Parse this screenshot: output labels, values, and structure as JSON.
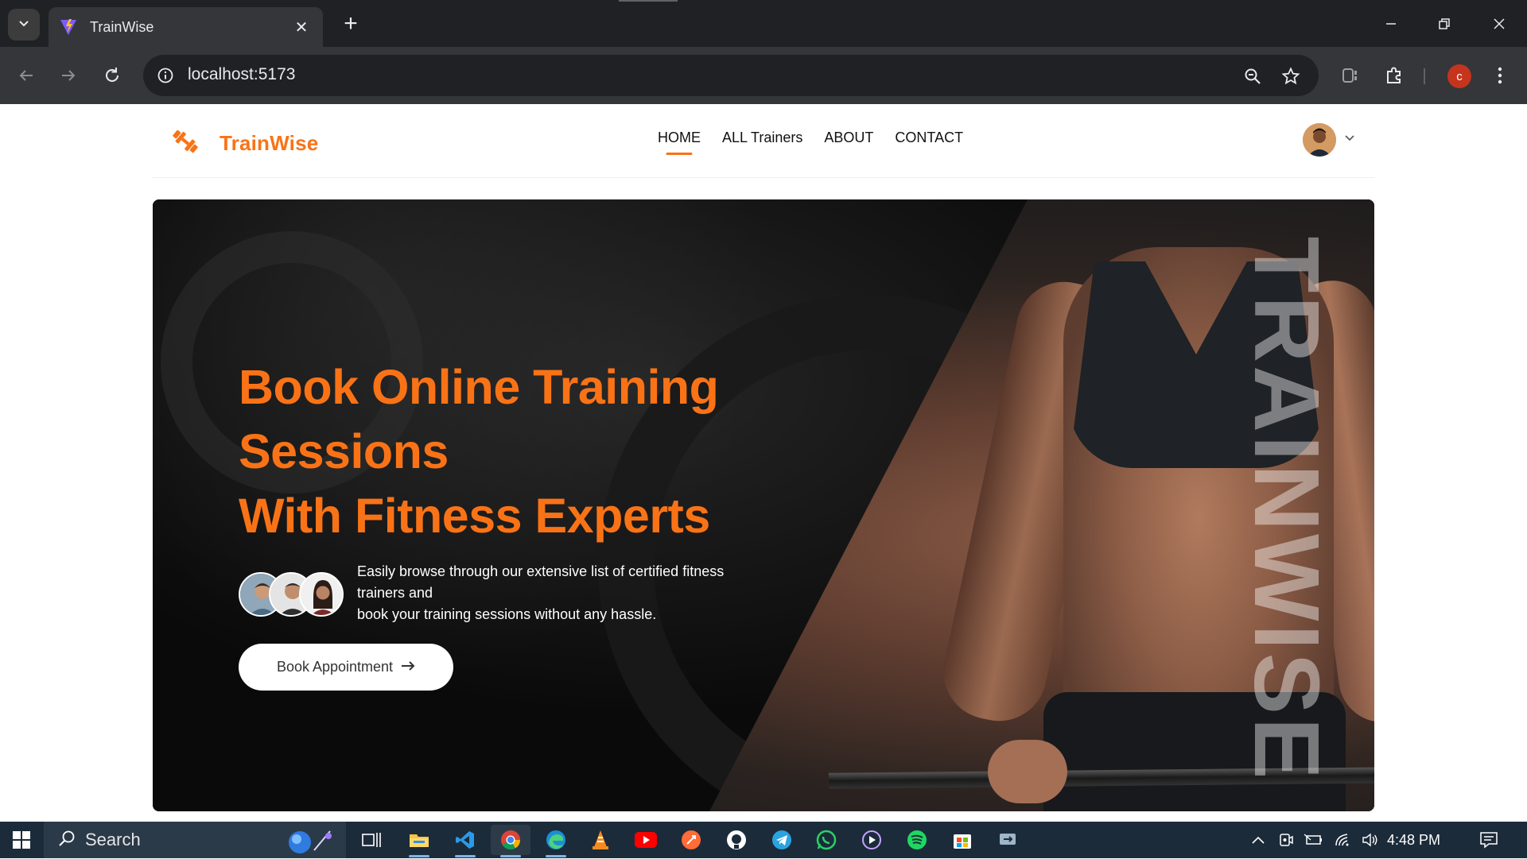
{
  "browser": {
    "tab_title": "TrainWise",
    "url": "localhost:5173",
    "profile_initial": "c"
  },
  "site": {
    "brand": "TrainWise",
    "nav": [
      {
        "label": "HOME",
        "active": true
      },
      {
        "label": "ALL Trainers",
        "active": false
      },
      {
        "label": "ABOUT",
        "active": false
      },
      {
        "label": "CONTACT",
        "active": false
      }
    ],
    "hero": {
      "title_lines": [
        "Book Online Training",
        "Sessions",
        "With Fitness Experts"
      ],
      "description_lines": [
        "Easily browse through our extensive list of certified fitness",
        "trainers and",
        "book your training sessions without any hassle."
      ],
      "cta": "Book Appointment",
      "watermark": "TRAINWISE"
    }
  },
  "taskbar": {
    "search_placeholder": "Search",
    "time": "4:48 PM"
  },
  "colors": {
    "accent": "#f97316",
    "tabbar": "#202124",
    "toolbar": "#35363a",
    "taskbar": "#1c2b3a"
  }
}
